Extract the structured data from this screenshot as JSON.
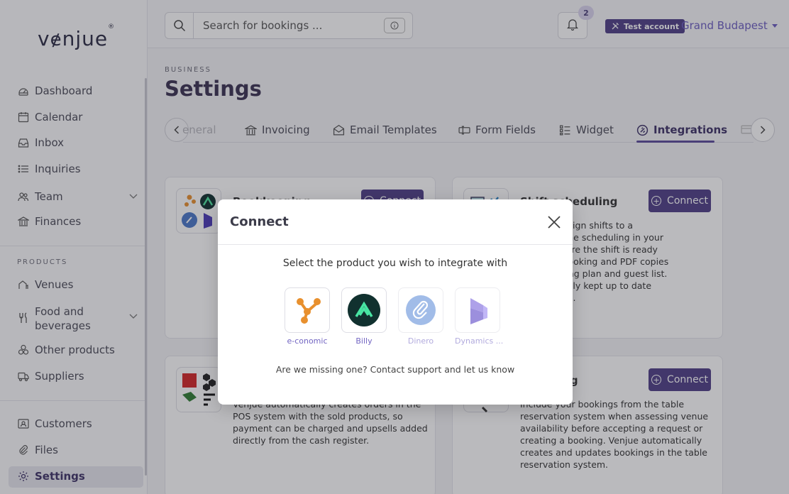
{
  "brand": {
    "logo": "venue",
    "mark": "®"
  },
  "sidebar": {
    "items": [
      {
        "label": "Dashboard",
        "icon": "dashboard-gauge-icon"
      },
      {
        "label": "Calendar",
        "icon": "calendar-icon"
      },
      {
        "label": "Inbox",
        "icon": "inbox-icon"
      },
      {
        "label": "Inquiries",
        "icon": "list-icon"
      },
      {
        "label": "Team",
        "icon": "team-icon"
      },
      {
        "label": "Finances",
        "icon": "bank-icon"
      }
    ],
    "products_label": "PRODUCTS",
    "products": [
      {
        "label": "Venues",
        "icon": "venues-icon"
      },
      {
        "label": "Food and beverages",
        "icon": "cutlery-icon"
      },
      {
        "label": "Other products",
        "icon": "products-icon"
      },
      {
        "label": "Suppliers",
        "icon": "truck-icon"
      }
    ],
    "bottom": [
      {
        "label": "Customers",
        "icon": "customers-icon"
      },
      {
        "label": "Files",
        "icon": "paperclip-icon"
      },
      {
        "label": "Settings",
        "icon": "gear-icon"
      }
    ]
  },
  "topbar": {
    "search_placeholder": "Search for bookings ...",
    "notifications_count": "2",
    "test_account": "Test account",
    "venue": "Grand Budapest"
  },
  "page": {
    "kicker": "BUSINESS",
    "title": "Settings",
    "tabs": [
      "eneral",
      "Invoicing",
      "Email Templates",
      "Form Fields",
      "Widget",
      "Integrations"
    ]
  },
  "cards": [
    {
      "title": "Bookkeeping",
      "button": "Connect",
      "description": ""
    },
    {
      "title": "Shift scheduling",
      "button": "Connect",
      "description": [
        "you can assign shifts to a",
        "complete the scheduling in your",
        "ystem, where the shift is ready",
        "ce to the booking and PDF copies",
        "heet, Seating plan and guest list.",
        "automatically kept up to date",
        "th in Venjue."
      ]
    },
    {
      "title": "",
      "button": "",
      "description": [
        "Venjue automatically creates orders in the",
        "POS system with the sold products, so",
        "payment can be charged and upsells added",
        "directly from the cash register."
      ]
    },
    {
      "title": "ing",
      "button": "Connect",
      "description": [
        "Include your bookings from the table",
        "reservation system when assessing venue",
        "availability before accepting a request or",
        "creating a booking. Venjue automatically",
        "creates and updates bookings in the table",
        "reservation system."
      ]
    }
  ],
  "modal": {
    "title": "Connect",
    "prompt": "Select the product you wish to integrate with",
    "products": [
      {
        "name": "e-conomic",
        "icon": "e-conomic-logo"
      },
      {
        "name": "Billy",
        "icon": "billy-logo"
      },
      {
        "name": "Dinero",
        "icon": "dinero-logo"
      },
      {
        "name": "Dynamics ...",
        "icon": "dynamics-logo"
      }
    ],
    "footer": "Are we missing one? Contact support and let us know"
  },
  "colors": {
    "accent": "#4e3f87",
    "link": "#7265c2"
  }
}
